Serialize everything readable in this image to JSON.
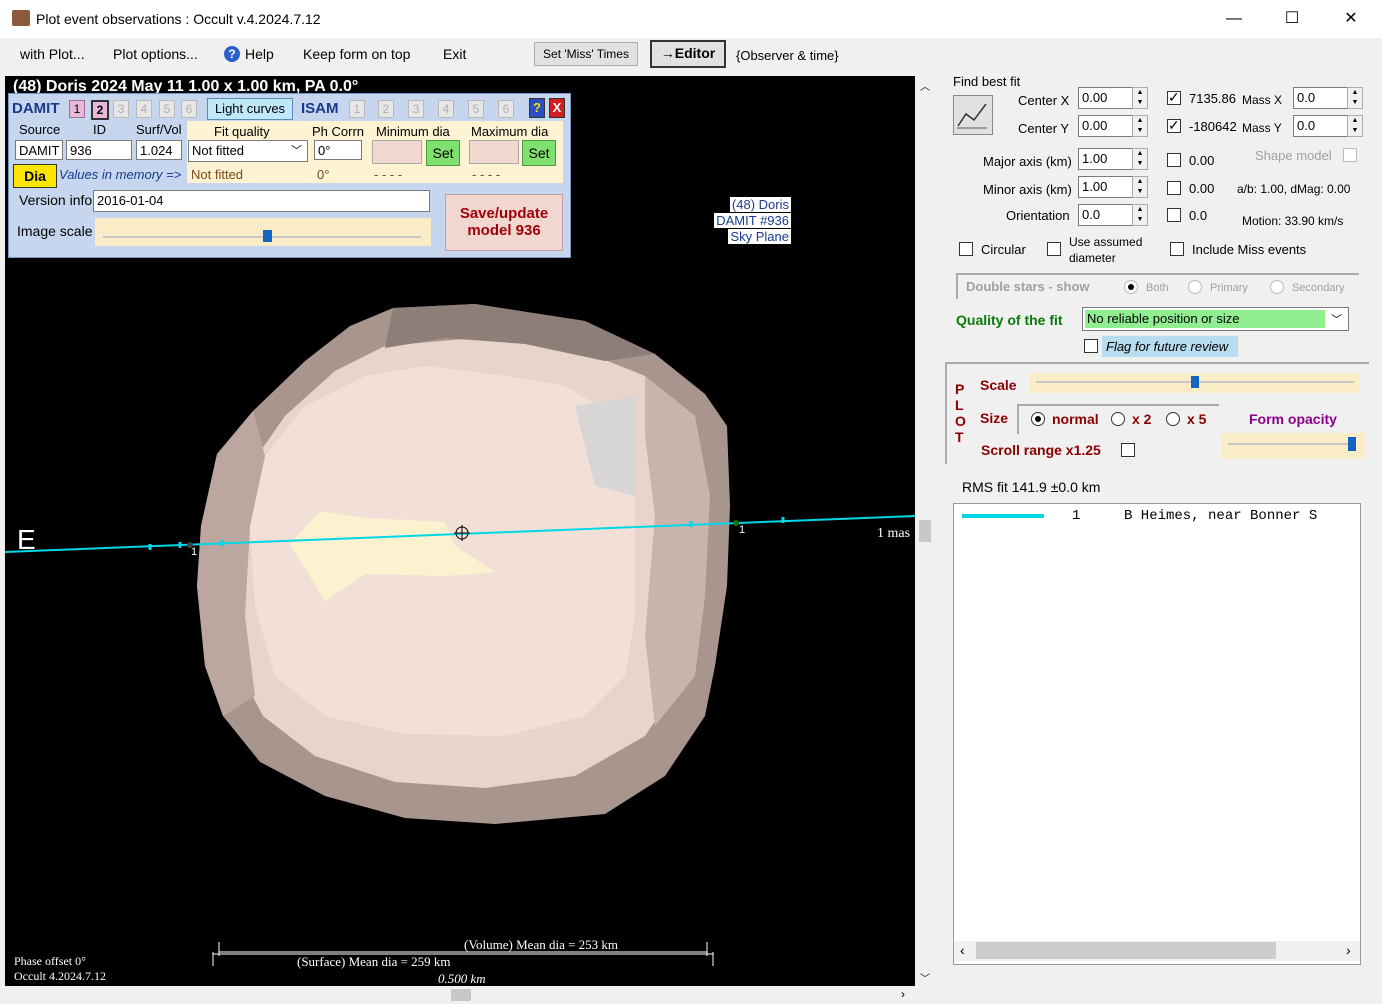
{
  "window": {
    "title": "Plot event observations : Occult v.4.2024.7.12",
    "minimize": "—",
    "maximize": "☐",
    "close": "✕"
  },
  "menu": {
    "with_plot": "with Plot...",
    "plot_options": "Plot options...",
    "help": "Help",
    "keep_on_top": "Keep form on top",
    "exit": "Exit",
    "set_miss_times": "Set 'Miss' Times",
    "editor": "→Editor",
    "observer_time": "{Observer & time}"
  },
  "plot": {
    "heading": "(48) Doris  2024 May 11   1.00 x 1.00 km, PA 0.0°",
    "east_label": "E",
    "scale_label": "1 mas",
    "chord_id_left": "1",
    "chord_id_right": "1",
    "legend": [
      "(48) Doris",
      "DAMIT #936",
      "Sky Plane"
    ],
    "volume_mean": "(Volume) Mean dia = 253 km",
    "surface_mean": "(Surface) Mean dia = 259 km",
    "scale_km": "0.500 km",
    "phase_offset": "Phase offset 0°",
    "version": "Occult 4.2024.7.12"
  },
  "damit_panel": {
    "damit_label": "DAMIT",
    "damit_tabs": [
      "1",
      "2",
      "3",
      "4",
      "5",
      "6"
    ],
    "light_curves": "Light curves",
    "isam_label": "ISAM",
    "isam_tabs": [
      "1",
      "2",
      "3",
      "4",
      "5",
      "6"
    ],
    "help_btn": "?",
    "close_btn": "X",
    "source_label": "Source",
    "id_label": "ID",
    "surf_vol_label": "Surf/Vol",
    "fit_quality_label": "Fit quality",
    "ph_corrn_label": "Ph Corrn",
    "min_dia_label": "Minimum dia",
    "max_dia_label": "Maximum dia",
    "source_value": "DAMIT",
    "id_value": "936",
    "surf_vol_value": "1.024",
    "fit_quality_value": "Not fitted",
    "ph_corrn_value": "0°",
    "set_label": "Set",
    "dia_btn": "Dia",
    "values_in_memory": "Values in memory =>",
    "mem_fit": "Not fitted",
    "mem_ph": "0°",
    "mem_min": "- - - -",
    "mem_max": "- - - -",
    "version_info_label": "Version info",
    "version_info_value": "2016-01-04",
    "image_scale_label": "Image scale",
    "save_update": "Save/update",
    "model_label": "model 936"
  },
  "right_panel": {
    "find_best_fit": "Find best fit",
    "center_x_label": "Center X",
    "center_x": "0.00",
    "center_y_label": "Center Y",
    "center_y": "0.00",
    "mass_x_val": "7135.86",
    "mass_x_label": "Mass X",
    "mass_x": "0.0",
    "mass_y_val": "-180642",
    "mass_y_label": "Mass Y",
    "mass_y": "0.0",
    "major_label": "Major axis (km)",
    "major": "1.00",
    "major_fit": "0.00",
    "minor_label": "Minor axis (km)",
    "minor": "1.00",
    "minor_fit": "0.00",
    "orientation_label": "Orientation",
    "orientation": "0.0",
    "orientation_fit": "0.0",
    "shape_model": "Shape model",
    "ab_dmag": "a/b: 1.00, dMag: 0.00",
    "motion": "Motion: 33.90 km/s",
    "circular": "Circular",
    "use_assumed": "Use assumed",
    "diameter": "diameter",
    "include_miss": "Include Miss events",
    "double_stars": "Double stars - show",
    "both": "Both",
    "primary": "Primary",
    "secondary": "Secondary",
    "quality_label": "Quality of the fit",
    "quality_value": "No reliable position or size",
    "flag_review": "Flag for future review",
    "plot_letters": [
      "P",
      "L",
      "O",
      "T"
    ],
    "scale_label": "Scale",
    "size_label": "Size",
    "size_normal": "normal",
    "size_x2": "x 2",
    "size_x5": "x 5",
    "form_opacity": "Form opacity",
    "scroll_range": "Scroll range x1.25",
    "rms_fit": "RMS fit 141.9 ±0.0 km",
    "obs_num": "1",
    "obs_name": "B Heimes, near Bonner S"
  },
  "colors": {
    "chord": "#00d8e8",
    "asteroid": "#efd9d0",
    "save_text": "#a0000a"
  }
}
